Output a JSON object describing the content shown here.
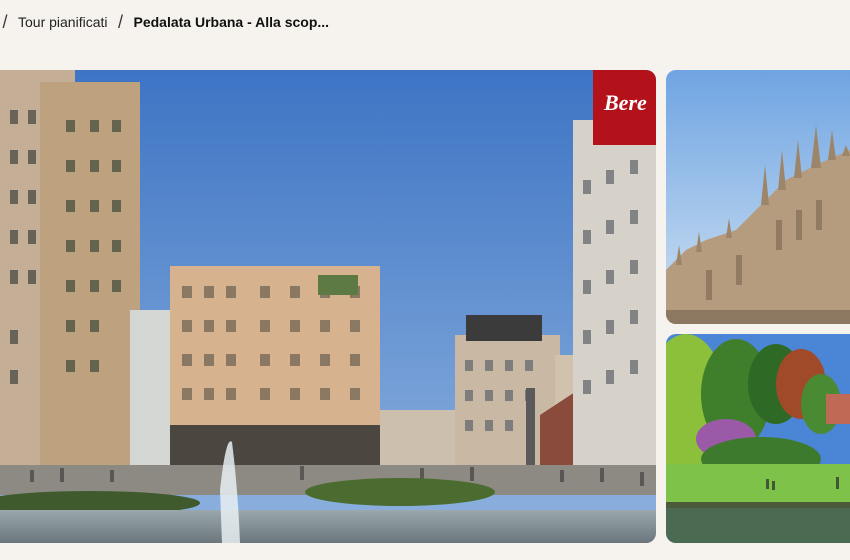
{
  "breadcrumb": {
    "items": [
      {
        "label": "Tour pianificati"
      }
    ],
    "current": "Pedalata Urbana - Alla scop..."
  },
  "gallery": {
    "main_photo": {
      "icon": "city-square-photo",
      "sign_text": "Bere"
    },
    "top_photo": {
      "icon": "cathedral-photo"
    },
    "bottom_photo": {
      "icon": "park-photo"
    }
  },
  "colors": {
    "background": "#f6f3ee",
    "sky": "#4f86cf",
    "building": "#c8a98a"
  }
}
